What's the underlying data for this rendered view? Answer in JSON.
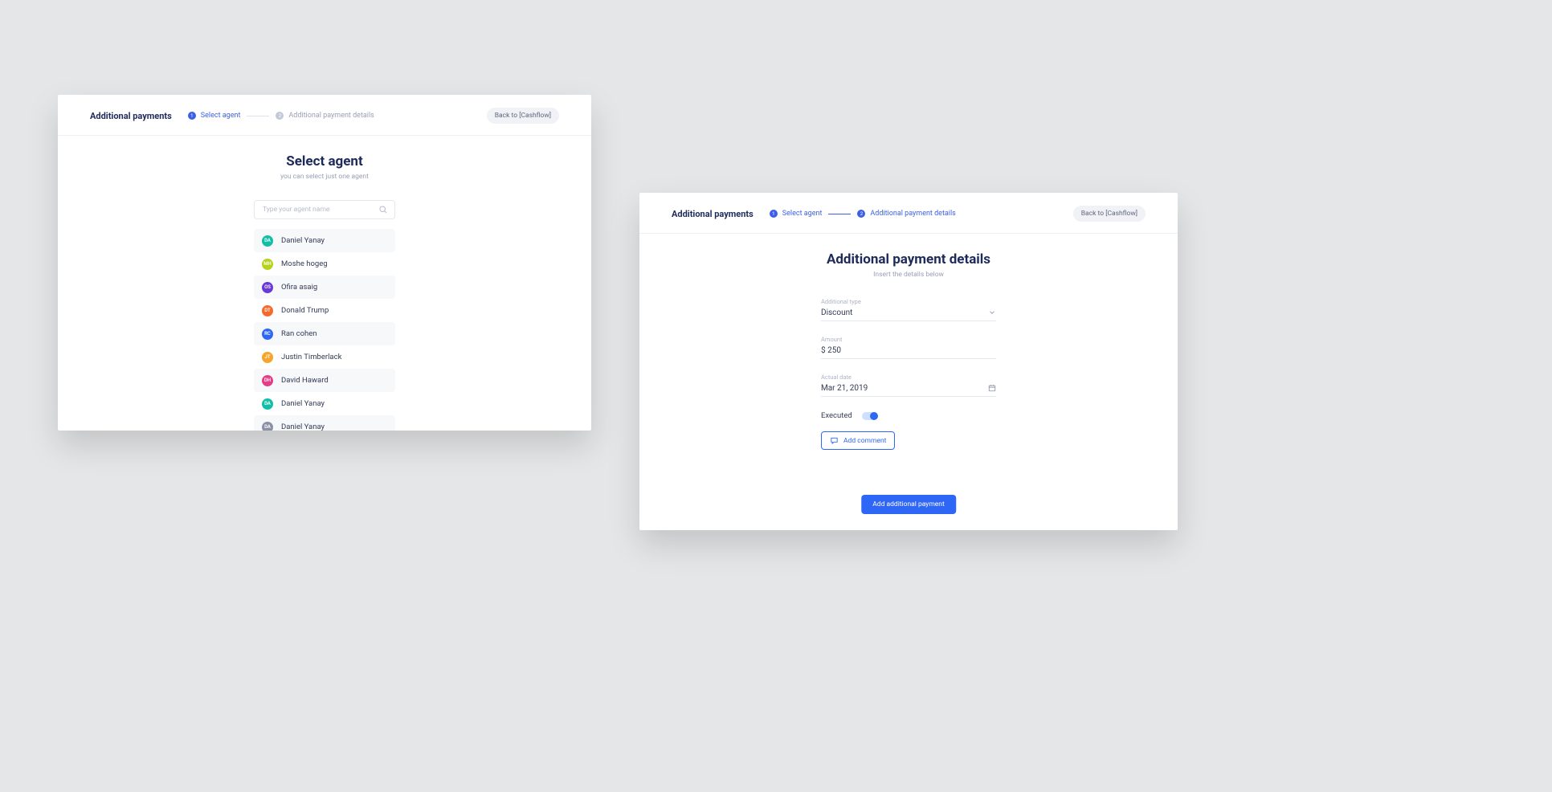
{
  "colors": {
    "accent": "#2e66f6",
    "heading": "#1d2a5a"
  },
  "screen1": {
    "header": {
      "title": "Additional payments",
      "back": "Back to [Cashflow]",
      "steps": [
        {
          "num": "1",
          "label": "Select agent",
          "state": "active"
        },
        {
          "num": "2",
          "label": "Additional payment details",
          "state": "pending"
        }
      ]
    },
    "title": "Select agent",
    "subtitle": "you can select just one agent",
    "search_placeholder": "Type your agent name",
    "agents": [
      {
        "initials": "DA",
        "name": "Daniel Yanay",
        "color": "#12bfa6"
      },
      {
        "initials": "MH",
        "name": "Moshe hogeg",
        "color": "#b6d21a"
      },
      {
        "initials": "OS",
        "name": "Ofira asaig",
        "color": "#6a39d6"
      },
      {
        "initials": "DT",
        "name": "Donald Trump",
        "color": "#f56a2c"
      },
      {
        "initials": "RC",
        "name": "Ran cohen",
        "color": "#2e66f6"
      },
      {
        "initials": "JT",
        "name": "Justin Timberlack",
        "color": "#f5a52c"
      },
      {
        "initials": "DH",
        "name": "David Haward",
        "color": "#e63c86"
      },
      {
        "initials": "DA",
        "name": "Daniel Yanay",
        "color": "#12bfa6"
      },
      {
        "initials": "DA",
        "name": "Daniel Yanay",
        "color": "#8a90a6"
      }
    ]
  },
  "screen2": {
    "header": {
      "title": "Additional payments",
      "back": "Back to [Cashflow]",
      "steps": [
        {
          "num": "1",
          "label": "Select agent",
          "state": "done"
        },
        {
          "num": "2",
          "label": "Additional payment details",
          "state": "active"
        }
      ]
    },
    "title": "Additional payment details",
    "subtitle": "Insert the details below",
    "form": {
      "type_label": "Additional type",
      "type_value": "Discount",
      "amount_label": "Amount",
      "amount_value": "$ 250",
      "date_label": "Actual date",
      "date_value": "Mar 21, 2019",
      "executed_label": "Executed",
      "executed_on": true,
      "add_comment": "Add comment",
      "submit": "Add additional payment"
    }
  }
}
